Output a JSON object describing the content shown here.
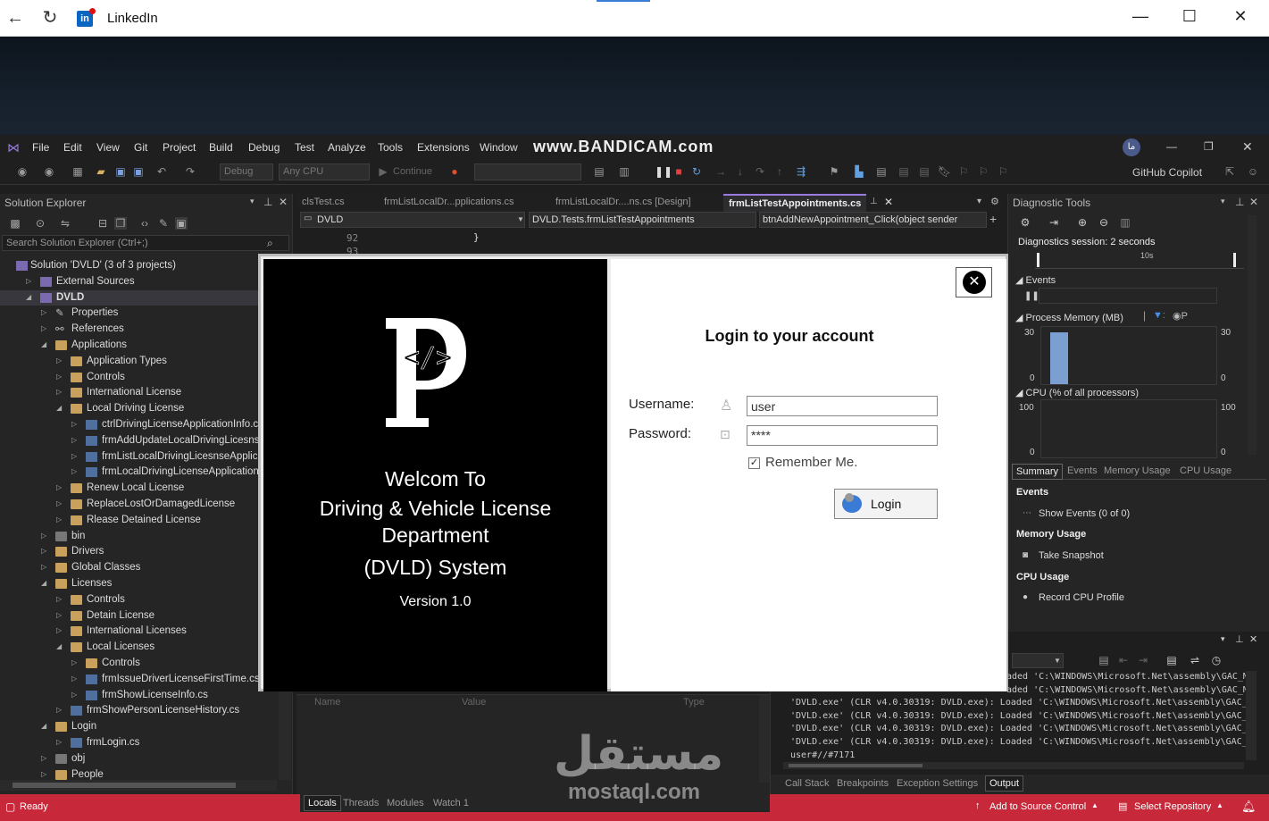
{
  "browser": {
    "title": "LinkedIn"
  },
  "menu": [
    "File",
    "Edit",
    "View",
    "Git",
    "Project",
    "Build",
    "Debug",
    "Test",
    "Analyze",
    "Tools",
    "Extensions",
    "Window"
  ],
  "watermark_top": "www.BANDICAM.com",
  "toolbar": {
    "config": "Debug",
    "platform": "Any CPU",
    "continue_label": "Continue",
    "copilot": "GitHub Copilot"
  },
  "solution_explorer": {
    "title": "Solution Explorer",
    "search_placeholder": "Search Solution Explorer (Ctrl+;)",
    "items": [
      {
        "label": "Solution 'DVLD' (3 of 3 projects)",
        "depth": 0,
        "arrow": "",
        "icon": "sln"
      },
      {
        "label": "External Sources",
        "depth": 1,
        "arrow": "▷",
        "icon": "proj"
      },
      {
        "label": "DVLD",
        "depth": 1,
        "arrow": "◢",
        "icon": "proj",
        "bold": true
      },
      {
        "label": "Properties",
        "depth": 2,
        "arrow": "▷",
        "icon": "wrench"
      },
      {
        "label": "References",
        "depth": 2,
        "arrow": "▷",
        "icon": "ref"
      },
      {
        "label": "Applications",
        "depth": 2,
        "arrow": "◢",
        "icon": "fold"
      },
      {
        "label": "Application Types",
        "depth": 3,
        "arrow": "▷",
        "icon": "fold"
      },
      {
        "label": "Controls",
        "depth": 3,
        "arrow": "▷",
        "icon": "fold"
      },
      {
        "label": "International License",
        "depth": 3,
        "arrow": "▷",
        "icon": "fold"
      },
      {
        "label": "Local Driving License",
        "depth": 3,
        "arrow": "◢",
        "icon": "fold"
      },
      {
        "label": "ctrlDrivingLicenseApplicationInfo.cs",
        "depth": 4,
        "arrow": "▷",
        "icon": "file"
      },
      {
        "label": "frmAddUpdateLocalDrivingLicesnseAp",
        "depth": 4,
        "arrow": "▷",
        "icon": "file"
      },
      {
        "label": "frmListLocalDrivingLicesnseApplicatio",
        "depth": 4,
        "arrow": "▷",
        "icon": "file"
      },
      {
        "label": "frmLocalDrivingLicenseApplicationInf",
        "depth": 4,
        "arrow": "▷",
        "icon": "file"
      },
      {
        "label": "Renew Local License",
        "depth": 3,
        "arrow": "▷",
        "icon": "fold"
      },
      {
        "label": "ReplaceLostOrDamagedLicense",
        "depth": 3,
        "arrow": "▷",
        "icon": "fold"
      },
      {
        "label": "Rlease Detained License",
        "depth": 3,
        "arrow": "▷",
        "icon": "fold"
      },
      {
        "label": "bin",
        "depth": 2,
        "arrow": "▷",
        "icon": "foldgrey"
      },
      {
        "label": "Drivers",
        "depth": 2,
        "arrow": "▷",
        "icon": "fold"
      },
      {
        "label": "Global Classes",
        "depth": 2,
        "arrow": "▷",
        "icon": "fold"
      },
      {
        "label": "Licenses",
        "depth": 2,
        "arrow": "◢",
        "icon": "fold"
      },
      {
        "label": "Controls",
        "depth": 3,
        "arrow": "▷",
        "icon": "fold"
      },
      {
        "label": "Detain License",
        "depth": 3,
        "arrow": "▷",
        "icon": "fold"
      },
      {
        "label": "International Licenses",
        "depth": 3,
        "arrow": "▷",
        "icon": "fold"
      },
      {
        "label": "Local Licenses",
        "depth": 3,
        "arrow": "◢",
        "icon": "fold"
      },
      {
        "label": "Controls",
        "depth": 4,
        "arrow": "▷",
        "icon": "fold"
      },
      {
        "label": "frmIssueDriverLicenseFirstTime.cs",
        "depth": 4,
        "arrow": "▷",
        "icon": "file"
      },
      {
        "label": "frmShowLicenseInfo.cs",
        "depth": 4,
        "arrow": "▷",
        "icon": "file"
      },
      {
        "label": "frmShowPersonLicenseHistory.cs",
        "depth": 3,
        "arrow": "▷",
        "icon": "file"
      },
      {
        "label": "Login",
        "depth": 2,
        "arrow": "◢",
        "icon": "fold"
      },
      {
        "label": "frmLogin.cs",
        "depth": 3,
        "arrow": "▷",
        "icon": "file"
      },
      {
        "label": "obj",
        "depth": 2,
        "arrow": "▷",
        "icon": "foldgrey"
      },
      {
        "label": "People",
        "depth": 2,
        "arrow": "▷",
        "icon": "fold"
      }
    ]
  },
  "tabs": [
    "clsTest.cs",
    "frmListLocalDr...pplications.cs",
    "frmListLocalDr....ns.cs [Design]",
    "frmListTestAppointments.cs"
  ],
  "editor": {
    "nav_project": "DVLD",
    "nav_class": "DVLD.Tests.frmListTestAppointments",
    "nav_member": "btnAddNewAppointment_Click(object sender",
    "line_numbers": [
      "92",
      "93"
    ],
    "line_92_code": "}"
  },
  "splash": {
    "line1": "Welcom To",
    "line2": "Driving & Vehicle License",
    "line3": "Department",
    "line4": "(DVLD) System",
    "version": "Version 1.0"
  },
  "login": {
    "heading": "Login to your account",
    "username_label": "Username:",
    "username_value": "user",
    "password_label": "Password:",
    "password_value": "****",
    "remember_label": "Remember Me.",
    "login_button": "Login"
  },
  "diagnostics": {
    "title": "Diagnostic Tools",
    "session": "Diagnostics session: 2 seconds",
    "timeline_mark": "10s",
    "events_label": "Events",
    "memory_label": "Process Memory (MB)",
    "memory_legend_p": "P",
    "mem_max": "30",
    "mem_min": "0",
    "cpu_label": "CPU (% of all processors)",
    "cpu_max": "100",
    "cpu_min": "0",
    "tabs": [
      "Summary",
      "Events",
      "Memory Usage",
      "CPU Usage"
    ],
    "sections": [
      {
        "heading": "Events",
        "action": "Show Events (0 of 0)"
      },
      {
        "heading": "Memory Usage",
        "action": "Take Snapshot"
      },
      {
        "heading": "CPU Usage",
        "action": "Record CPU Profile"
      }
    ]
  },
  "output": {
    "lines": [
      "aded 'C:\\WINDOWS\\Microsoft.Net\\assembly\\GAC_M",
      "aded 'C:\\WINDOWS\\Microsoft.Net\\assembly\\GAC_M",
      "'DVLD.exe' (CLR v4.0.30319: DVLD.exe): Loaded 'C:\\WINDOWS\\Microsoft.Net\\assembly\\GAC_M",
      "'DVLD.exe' (CLR v4.0.30319: DVLD.exe): Loaded 'C:\\WINDOWS\\Microsoft.Net\\assembly\\GAC_M",
      "'DVLD.exe' (CLR v4.0.30319: DVLD.exe): Loaded 'C:\\WINDOWS\\Microsoft.Net\\assembly\\GAC_M",
      "'DVLD.exe' (CLR v4.0.30319: DVLD.exe): Loaded 'C:\\WINDOWS\\Microsoft.Net\\assembly\\GAC_M",
      "user#//#7171"
    ],
    "tabs": [
      "Call Stack",
      "Breakpoints",
      "Exception Settings",
      "Output"
    ]
  },
  "locals": {
    "columns": [
      "Name",
      "Value",
      "Type"
    ],
    "tabs": [
      "Locals",
      "Threads",
      "Modules",
      "Watch 1"
    ]
  },
  "status": {
    "ready": "Ready",
    "source_control": "Add to Source Control",
    "repo": "Select Repository"
  },
  "watermark": {
    "arabic": "مستقل",
    "latin": "mostaql.com"
  }
}
